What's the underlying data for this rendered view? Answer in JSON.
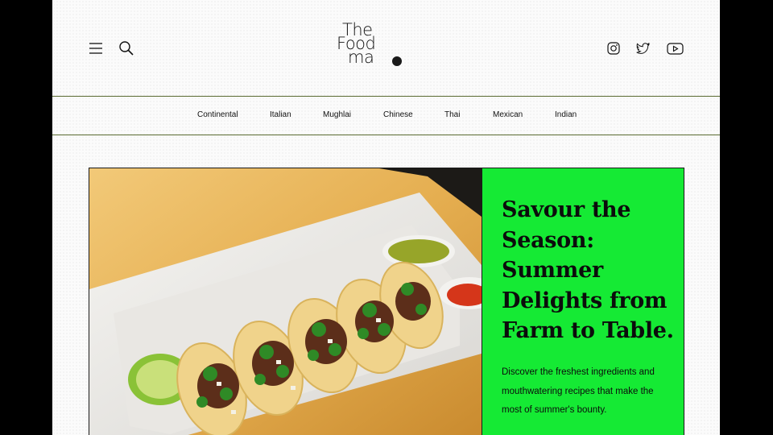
{
  "logo": {
    "line1": "The",
    "line2": "Food",
    "line3": "ma"
  },
  "nav": {
    "items": [
      "Continental",
      "Italian",
      "Mughlai",
      "Chinese",
      "Thai",
      "Mexican",
      "Indian"
    ]
  },
  "hero": {
    "title": "Savour the Season: Summer Delights from Farm to Table.",
    "description": "Discover the freshest ingredients and mouthwatering recipes that make the most of summer's bounty."
  },
  "colors": {
    "accent": "#15ea34",
    "rule": "#5a6b32",
    "frame": "#000000"
  },
  "icons": [
    "menu-icon",
    "search-icon",
    "instagram-icon",
    "twitter-icon",
    "youtube-icon"
  ]
}
